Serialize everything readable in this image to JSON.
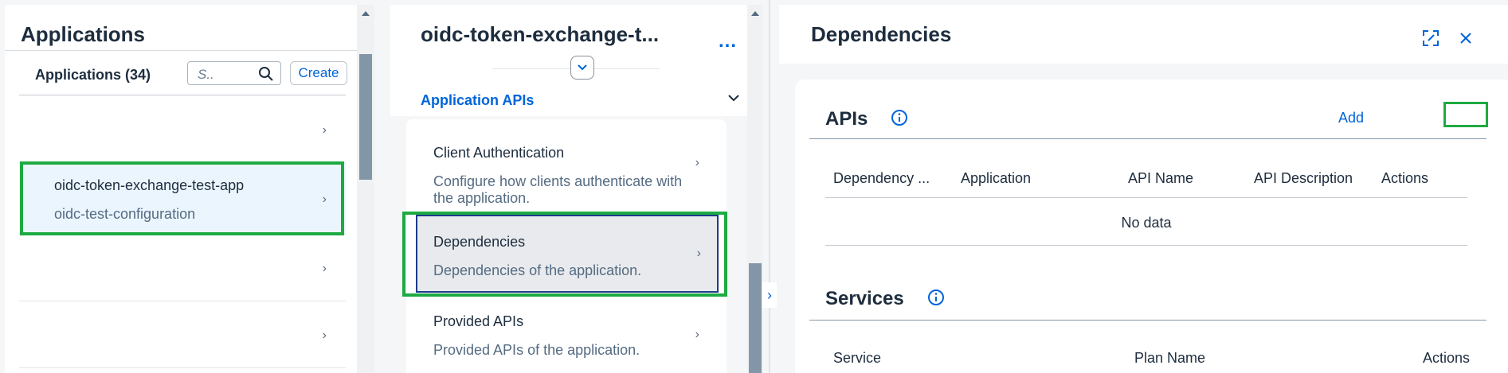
{
  "applications": {
    "title": "Applications",
    "list_title": "Applications (34)",
    "search_placeholder": "S..",
    "create_label": "Create",
    "items": [
      {
        "title": "",
        "subtitle": ""
      },
      {
        "title": "oidc-token-exchange-test-app",
        "subtitle": "oidc-test-configuration"
      },
      {
        "title": "",
        "subtitle": ""
      },
      {
        "title": "",
        "subtitle": ""
      }
    ]
  },
  "app_detail": {
    "title": "oidc-token-exchange-t...",
    "more_label": "...",
    "section_label": "Application APIs",
    "nav_items": [
      {
        "title": "Client Authentication",
        "description": "Configure how clients authenticate with the application."
      },
      {
        "title": "Dependencies",
        "description": "Dependencies of the application."
      },
      {
        "title": "Provided APIs",
        "description": "Provided APIs of the application."
      }
    ]
  },
  "dependencies": {
    "title": "Dependencies",
    "apis": {
      "title": "APIs",
      "add_label": "Add",
      "columns": [
        "Dependency ...",
        "Application",
        "API Name",
        "API Description",
        "Actions"
      ],
      "empty_text": "No data"
    },
    "services": {
      "title": "Services",
      "columns": [
        "Service",
        "Plan Name",
        "Actions"
      ]
    }
  },
  "colors": {
    "accent": "#0064d9",
    "highlight": "#1eaa42",
    "selected_bg": "#ebf5fe",
    "text": "#1d2d3e"
  }
}
